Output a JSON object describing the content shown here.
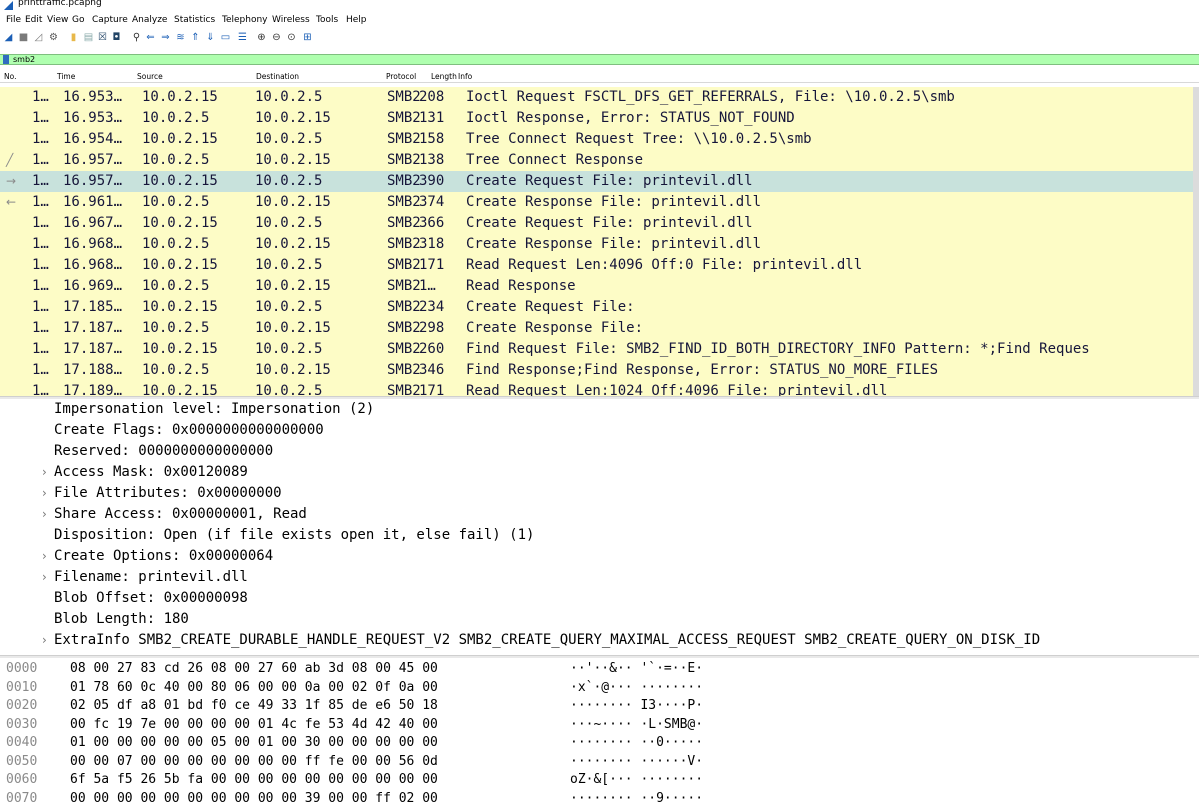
{
  "window": {
    "title": "printtraffic.pcapng"
  },
  "menu": [
    "File",
    "Edit",
    "View",
    "Go",
    "Capture",
    "Analyze",
    "Statistics",
    "Telephony",
    "Wireless",
    "Tools",
    "Help"
  ],
  "toolbar_icons": [
    "shark-fin-start-icon",
    "stop-icon",
    "restart-icon",
    "options-gear-icon",
    "open-file-icon",
    "save-file-icon",
    "close-file-icon",
    "reload-icon",
    "find-packet-icon",
    "go-back-icon",
    "go-forward-icon",
    "go-to-packet-icon",
    "go-first-icon",
    "go-last-icon",
    "auto-scroll-icon",
    "colorize-icon",
    "zoom-in-icon",
    "zoom-out-icon",
    "zoom-normal-icon",
    "resize-columns-icon"
  ],
  "filter": {
    "value": "smb2"
  },
  "columns": {
    "no": "No.",
    "time": "Time",
    "source": "Source",
    "destination": "Destination",
    "protocol": "Protocol",
    "length": "Length",
    "info": "Info"
  },
  "packets": [
    {
      "no": "1…",
      "time": "16.953…",
      "src": "10.0.2.15",
      "dst": "10.0.2.5",
      "proto": "SMB2",
      "len": "208",
      "info": "Ioctl Request FSCTL_DFS_GET_REFERRALS, File: \\10.0.2.5\\smb"
    },
    {
      "no": "1…",
      "time": "16.953…",
      "src": "10.0.2.5",
      "dst": "10.0.2.15",
      "proto": "SMB2",
      "len": "131",
      "info": "Ioctl Response, Error: STATUS_NOT_FOUND"
    },
    {
      "no": "1…",
      "time": "16.954…",
      "src": "10.0.2.15",
      "dst": "10.0.2.5",
      "proto": "SMB2",
      "len": "158",
      "info": "Tree Connect Request Tree: \\\\10.0.2.5\\smb"
    },
    {
      "no": "1…",
      "time": "16.957…",
      "src": "10.0.2.5",
      "dst": "10.0.2.15",
      "proto": "SMB2",
      "len": "138",
      "info": "Tree Connect Response"
    },
    {
      "no": "1…",
      "time": "16.957…",
      "src": "10.0.2.15",
      "dst": "10.0.2.5",
      "proto": "SMB2",
      "len": "390",
      "info": "Create Request File: printevil.dll"
    },
    {
      "no": "1…",
      "time": "16.961…",
      "src": "10.0.2.5",
      "dst": "10.0.2.15",
      "proto": "SMB2",
      "len": "374",
      "info": "Create Response File: printevil.dll"
    },
    {
      "no": "1…",
      "time": "16.967…",
      "src": "10.0.2.15",
      "dst": "10.0.2.5",
      "proto": "SMB2",
      "len": "366",
      "info": "Create Request File: printevil.dll"
    },
    {
      "no": "1…",
      "time": "16.968…",
      "src": "10.0.2.5",
      "dst": "10.0.2.15",
      "proto": "SMB2",
      "len": "318",
      "info": "Create Response File: printevil.dll"
    },
    {
      "no": "1…",
      "time": "16.968…",
      "src": "10.0.2.15",
      "dst": "10.0.2.5",
      "proto": "SMB2",
      "len": "171",
      "info": "Read Request Len:4096 Off:0 File: printevil.dll"
    },
    {
      "no": "1…",
      "time": "16.969…",
      "src": "10.0.2.5",
      "dst": "10.0.2.15",
      "proto": "SMB2",
      "len": "1…",
      "info": "Read Response"
    },
    {
      "no": "1…",
      "time": "17.185…",
      "src": "10.0.2.15",
      "dst": "10.0.2.5",
      "proto": "SMB2",
      "len": "234",
      "info": "Create Request File:"
    },
    {
      "no": "1…",
      "time": "17.187…",
      "src": "10.0.2.5",
      "dst": "10.0.2.15",
      "proto": "SMB2",
      "len": "298",
      "info": "Create Response File:"
    },
    {
      "no": "1…",
      "time": "17.187…",
      "src": "10.0.2.15",
      "dst": "10.0.2.5",
      "proto": "SMB2",
      "len": "260",
      "info": "Find Request File:  SMB2_FIND_ID_BOTH_DIRECTORY_INFO Pattern: *;Find Reques"
    },
    {
      "no": "1…",
      "time": "17.188…",
      "src": "10.0.2.5",
      "dst": "10.0.2.15",
      "proto": "SMB2",
      "len": "346",
      "info": "Find Response;Find Response, Error: STATUS_NO_MORE_FILES"
    },
    {
      "no": "1…",
      "time": "17.189…",
      "src": "10.0.2.15",
      "dst": "10.0.2.5",
      "proto": "SMB2",
      "len": "171",
      "info": "Read Request Len:1024 Off:4096 File: printevil.dll"
    }
  ],
  "selected_packet_index": 4,
  "details": [
    {
      "text": "Impersonation level: Impersonation (2)",
      "expandable": false
    },
    {
      "text": "Create Flags: 0x0000000000000000",
      "expandable": false
    },
    {
      "text": "Reserved: 0000000000000000",
      "expandable": false
    },
    {
      "text": "Access Mask: 0x00120089",
      "expandable": true
    },
    {
      "text": "File Attributes: 0x00000000",
      "expandable": true
    },
    {
      "text": "Share Access: 0x00000001, Read",
      "expandable": true
    },
    {
      "text": "Disposition: Open (if file exists open it, else fail) (1)",
      "expandable": false
    },
    {
      "text": "Create Options: 0x00000064",
      "expandable": true
    },
    {
      "text": "Filename: printevil.dll",
      "expandable": true
    },
    {
      "text": "Blob Offset: 0x00000098",
      "expandable": false
    },
    {
      "text": "Blob Length: 180",
      "expandable": false
    },
    {
      "text": "ExtraInfo SMB2_CREATE_DURABLE_HANDLE_REQUEST_V2 SMB2_CREATE_QUERY_MAXIMAL_ACCESS_REQUEST SMB2_CREATE_QUERY_ON_DISK_ID",
      "expandable": true
    }
  ],
  "expand_glyph": "›",
  "bytes": [
    {
      "off": "0000",
      "hex": "08 00 27 83 cd 26 08 00  27 60 ab 3d 08 00 45 00",
      "ascii": "··'··&·· '`·=··E·"
    },
    {
      "off": "0010",
      "hex": "01 78 60 0c 40 00 80 06  00 00 0a 00 02 0f 0a 00",
      "ascii": "·x`·@··· ········"
    },
    {
      "off": "0020",
      "hex": "02 05 df a8 01 bd f0 ce  49 33 1f 85 de e6 50 18",
      "ascii": "········ I3····P·"
    },
    {
      "off": "0030",
      "hex": "00 fc 19 7e 00 00 00 00  01 4c fe 53 4d 42 40 00",
      "ascii": "···~···· ·L·SMB@·"
    },
    {
      "off": "0040",
      "hex": "01 00 00 00 00 00 05 00  01 00 30 00 00 00 00 00",
      "ascii": "········ ··0·····"
    },
    {
      "off": "0050",
      "hex": "00 00 07 00 00 00 00 00  00 00 ff fe 00 00 56 0d",
      "ascii": "········ ······V·"
    },
    {
      "off": "0060",
      "hex": "6f 5a f5 26 5b fa 00 00  00 00 00 00 00 00 00 00",
      "ascii": "oZ·&[··· ········"
    },
    {
      "off": "0070",
      "hex": "00 00 00 00 00 00 00 00  00 00 39 00 00 ff 02 00",
      "ascii": "········ ··9·····"
    }
  ]
}
